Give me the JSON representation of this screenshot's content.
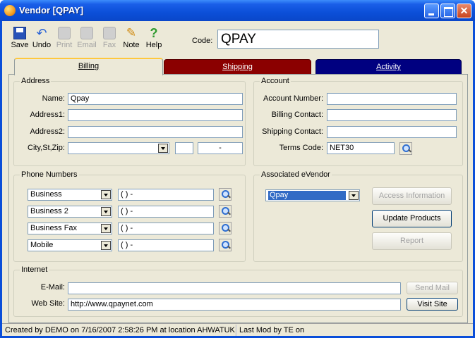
{
  "window": {
    "title": "Vendor [QPAY]"
  },
  "toolbar": {
    "save": "Save",
    "undo": "Undo",
    "print": "Print",
    "email": "Email",
    "fax": "Fax",
    "note": "Note",
    "help": "Help"
  },
  "code": {
    "label": "Code:",
    "value": "QPAY"
  },
  "tabs": {
    "billing": "Billing",
    "shipping": "Shipping",
    "activity": "Activity"
  },
  "address": {
    "title": "Address",
    "name_label": "Name:",
    "name_value": "Qpay",
    "address1_label": "Address1:",
    "address1_value": "",
    "address2_label": "Address2:",
    "address2_value": "",
    "city_label": "City,St,Zip:",
    "city_value": "",
    "state_value": "",
    "zip_value": "-"
  },
  "account": {
    "title": "Account",
    "number_label": "Account Number:",
    "number_value": "",
    "billing_contact_label": "Billing Contact:",
    "billing_contact_value": "",
    "shipping_contact_label": "Shipping Contact:",
    "shipping_contact_value": "",
    "terms_label": "Terms Code:",
    "terms_value": "NET30"
  },
  "phones": {
    "title": "Phone Numbers",
    "rows": [
      {
        "type": "Business",
        "number": "(   )   -"
      },
      {
        "type": "Business 2",
        "number": "(   )   -"
      },
      {
        "type": "Business Fax",
        "number": "(   )   -"
      },
      {
        "type": "Mobile",
        "number": "(   )   -"
      }
    ]
  },
  "evendor": {
    "title": "Associated eVendor",
    "selected": "Qpay",
    "access_info": "Access Information",
    "update_products": "Update Products",
    "report": "Report"
  },
  "internet": {
    "title": "Internet",
    "email_label": "E-Mail:",
    "email_value": "",
    "send_mail": "Send Mail",
    "website_label": "Web Site:",
    "website_value": "http://www.qpaynet.com",
    "visit_site": "Visit Site"
  },
  "status": {
    "created": "Created by DEMO on 7/16/2007 2:58:26 PM at location AHWATUK",
    "modified": "Last Mod by TE on"
  }
}
